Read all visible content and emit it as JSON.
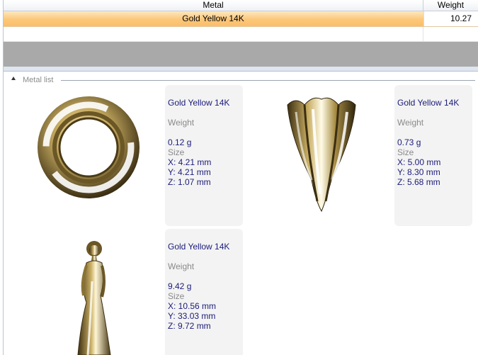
{
  "grid": {
    "columns": [
      "Metal",
      "Weight"
    ],
    "rows": [
      {
        "metal": "Gold Yellow 14K",
        "weight": "10.27"
      }
    ]
  },
  "metal_list": {
    "title": "Metal list",
    "items": [
      {
        "metal": "Gold Yellow 14K",
        "weight_label": "Weight",
        "weight": "0.12 g",
        "size_label": "Size",
        "x": "X: 4.21 mm",
        "y": "Y: 4.21 mm",
        "z": "Z: 1.07 mm",
        "thumbnail": "ring-thumbnail"
      },
      {
        "metal": "Gold Yellow 14K",
        "weight_label": "Weight",
        "weight": "0.73 g",
        "size_label": "Size",
        "x": "X: 5.00 mm",
        "y": "Y: 8.30 mm",
        "z": "Z: 5.68 mm",
        "thumbnail": "prong-thumbnail"
      },
      {
        "metal": "Gold Yellow 14K",
        "weight_label": "Weight",
        "weight": "9.42 g",
        "size_label": "Size",
        "x": "X: 10.56 mm",
        "y": "Y: 33.03 mm",
        "z": "Z: 9.72 mm",
        "thumbnail": "figure-thumbnail"
      }
    ]
  },
  "colors": {
    "selected_row": "#fcc77a",
    "info_text": "#1b1b7a",
    "label_text": "#8a8a8a",
    "gold": "#b39a55"
  }
}
